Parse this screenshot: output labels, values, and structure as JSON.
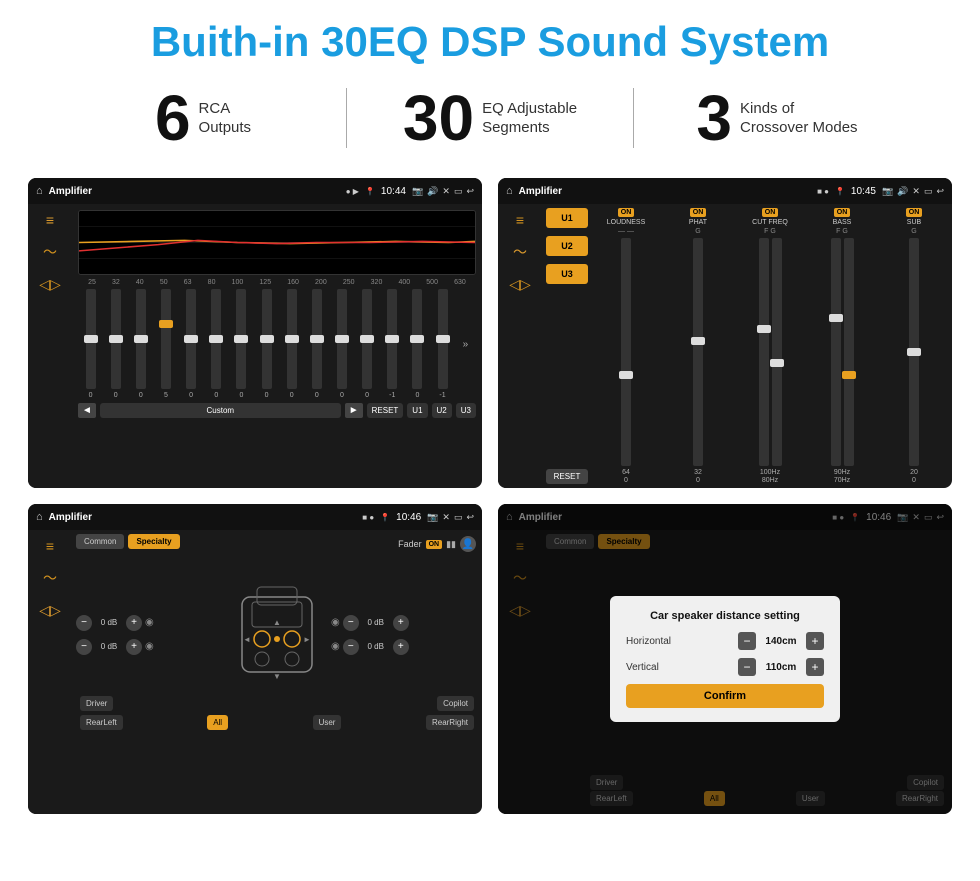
{
  "header": {
    "title": "Buith-in 30EQ DSP Sound System"
  },
  "stats": [
    {
      "number": "6",
      "text": "RCA\nOutputs"
    },
    {
      "number": "30",
      "text": "EQ Adjustable\nSegments"
    },
    {
      "number": "3",
      "text": "Kinds of\nCrossover Modes"
    }
  ],
  "screens": {
    "screen1": {
      "topbar": {
        "title": "Amplifier",
        "time": "10:44"
      },
      "eq": {
        "freqs": [
          "25",
          "32",
          "40",
          "50",
          "63",
          "80",
          "100",
          "125",
          "160",
          "200",
          "250",
          "320",
          "400",
          "500",
          "630"
        ],
        "values": [
          "0",
          "0",
          "0",
          "5",
          "0",
          "0",
          "0",
          "0",
          "0",
          "0",
          "0",
          "0",
          "-1",
          "0",
          "-1"
        ],
        "preset": "Custom",
        "buttons": [
          "RESET",
          "U1",
          "U2",
          "U3"
        ]
      }
    },
    "screen2": {
      "topbar": {
        "title": "Amplifier",
        "time": "10:45"
      },
      "bands": [
        "LOUDNESS",
        "PHAT",
        "CUT FREQ",
        "BASS",
        "SUB"
      ],
      "uButtons": [
        "U1",
        "U2",
        "U3"
      ],
      "resetLabel": "RESET"
    },
    "screen3": {
      "topbar": {
        "title": "Amplifier",
        "time": "10:46"
      },
      "tabs": [
        "Common",
        "Specialty"
      ],
      "activeTab": "Specialty",
      "faderLabel": "Fader",
      "faderOn": "ON",
      "volumes": [
        {
          "label": "",
          "value": "0 dB"
        },
        {
          "label": "",
          "value": "0 dB"
        },
        {
          "label": "",
          "value": "0 dB"
        },
        {
          "label": "",
          "value": "0 dB"
        }
      ],
      "bottomBtns": [
        "Driver",
        "RearLeft",
        "All",
        "User",
        "Copilot",
        "RearRight"
      ]
    },
    "screen4": {
      "topbar": {
        "title": "Amplifier",
        "time": "10:46"
      },
      "tabs": [
        "Common",
        "Specialty"
      ],
      "dialog": {
        "title": "Car speaker distance setting",
        "horizontal": {
          "label": "Horizontal",
          "value": "140cm"
        },
        "vertical": {
          "label": "Vertical",
          "value": "110cm"
        },
        "confirmLabel": "Confirm"
      },
      "bottomBtns": [
        "Driver",
        "RearLeft",
        "All",
        "User",
        "Copilot",
        "RearRight"
      ]
    }
  }
}
